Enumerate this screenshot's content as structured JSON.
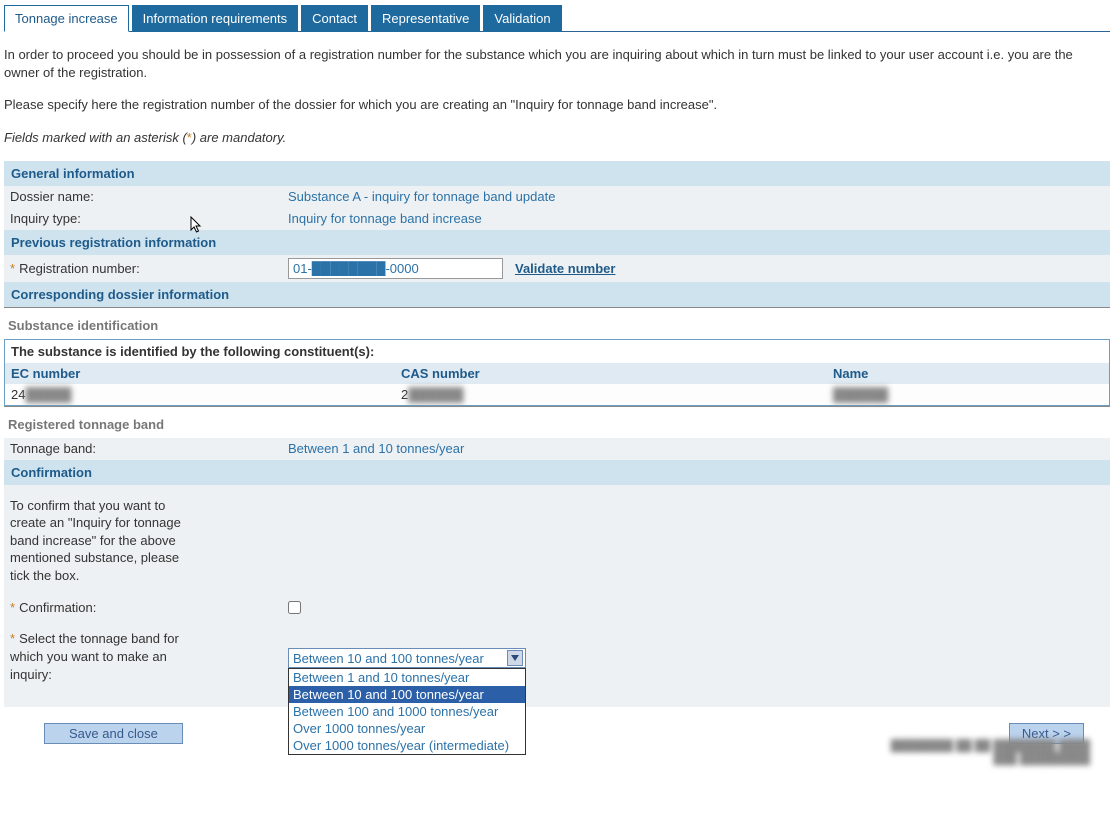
{
  "tabs": [
    {
      "label": "Tonnage increase"
    },
    {
      "label": "Information requirements"
    },
    {
      "label": "Contact"
    },
    {
      "label": "Representative"
    },
    {
      "label": "Validation"
    }
  ],
  "intro": {
    "p1": "In order to proceed you should be in possession of a registration number for the substance which you are inquiring about which in turn must be linked to your user account i.e. you are the owner of the registration.",
    "p2": "Please specify here the registration number of the dossier for which you are creating an \"Inquiry for tonnage band increase\".",
    "mandatory_pre": "Fields marked with an asterisk (",
    "mandatory_ast": "*",
    "mandatory_post": ") are mandatory."
  },
  "sections": {
    "general": {
      "title": "General information",
      "dossier_label": "Dossier name:",
      "dossier_value": "Substance A - inquiry for tonnage band update",
      "inquiry_label": "Inquiry type:",
      "inquiry_value": "Inquiry for tonnage band increase"
    },
    "previous": {
      "title": "Previous registration information",
      "reg_label": "Registration number:",
      "reg_value": "01-████████-0000",
      "validate": "Validate number"
    },
    "corresponding": {
      "title": "Corresponding dossier information"
    }
  },
  "substance": {
    "header": "Substance identification",
    "title": "The substance is identified by the following constituent(s):",
    "cols": {
      "ec": "EC number",
      "cas": "CAS number",
      "name": "Name"
    },
    "row": {
      "ec": "24█████",
      "cas": "2███████",
      "name": "██████"
    }
  },
  "tonnage": {
    "header": "Registered tonnage band",
    "label": "Tonnage band:",
    "value": "Between 1 and 10 tonnes/year"
  },
  "confirmation": {
    "title": "Confirmation",
    "instruction": "To confirm that you want to create an \"Inquiry for tonnage band increase\" for the above mentioned substance, please tick the box.",
    "confirm_label": "Confirmation:",
    "select_label": "Select the tonnage band for which you want to make an inquiry:",
    "dropdown_selected": "Between 10 and 100 tonnes/year",
    "options": [
      "Between 1 and 10 tonnes/year",
      "Between 10 and 100 tonnes/year",
      "Between 100 and 1000 tonnes/year",
      "Over 1000 tonnes/year",
      "Over 1000 tonnes/year (intermediate)"
    ]
  },
  "buttons": {
    "save": "Save and close",
    "next": "Next > >"
  },
  "footer_meta": {
    "line1": "████████ ██ ██ ████████ ████",
    "line2": "███ █████████"
  }
}
